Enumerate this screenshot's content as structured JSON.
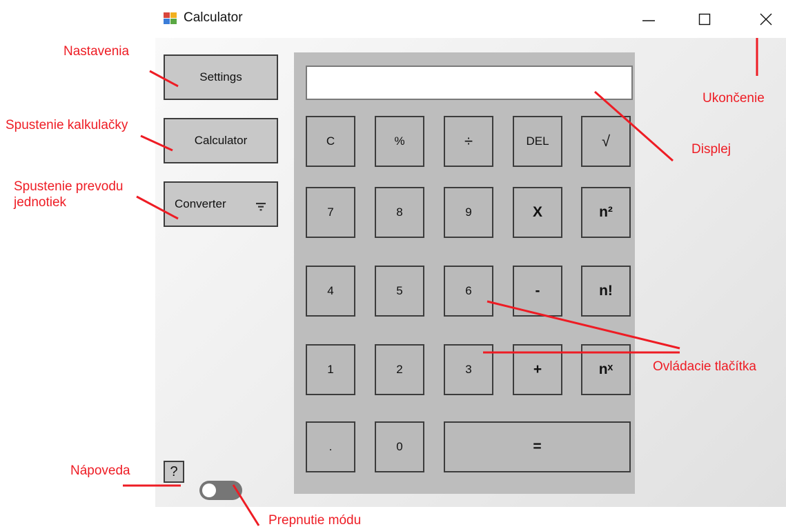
{
  "window": {
    "title": "Calculator",
    "controls": {
      "minimize": "minimize-icon",
      "maximize": "maximize-icon",
      "close": "close-icon"
    }
  },
  "sidebar": {
    "settings_label": "Settings",
    "calculator_label": "Calculator",
    "converter_label": "Converter",
    "converter_icon": "funnel-icon",
    "help_label": "?",
    "mode_toggle_on": false
  },
  "display": {
    "value": ""
  },
  "keypad": {
    "rows": [
      [
        "C",
        "%",
        "÷",
        "DEL",
        "√"
      ],
      [
        "7",
        "8",
        "9",
        "X",
        "n²"
      ],
      [
        "4",
        "5",
        "6",
        "-",
        "n!"
      ],
      [
        "1",
        "2",
        "3",
        "+",
        "nˣ"
      ],
      [
        ".",
        "0",
        "="
      ]
    ]
  },
  "annotations": {
    "nastavenia": "Nastavenia",
    "spustenie_kalkulacky": "Spustenie kalkulačky",
    "spustenie_prevodu_1": "Spustenie prevodu",
    "spustenie_prevodu_2": "jednotiek",
    "napoveda": "Nápoveda",
    "prepnutie_modu": "Prepnutie módu",
    "ukoncenie": "Ukončenie",
    "displej": "Displej",
    "ovladacie_tlacitka": "Ovládacie tlačítka"
  },
  "colors": {
    "annotation": "#ee1c24",
    "panel": "#bdbdbd",
    "button": "#c8c8c8",
    "border": "#3c3c3c",
    "toggle_off": "#767676"
  }
}
